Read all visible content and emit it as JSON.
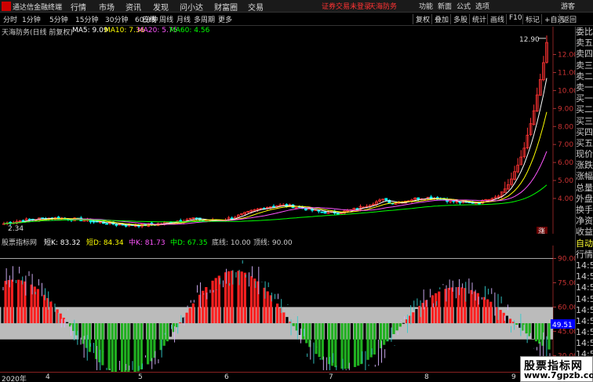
{
  "menubar": {
    "app_title": "通达信金融终端",
    "menus": [
      "行情",
      "市场",
      "资讯",
      "发现",
      "问小达",
      "财富圈",
      "交易"
    ],
    "warning": "证券交易未登录",
    "stock_name": "天海防务",
    "right_menus": [
      "功能",
      "新面",
      "公式",
      "选项"
    ],
    "user": "游客"
  },
  "toolbar": {
    "periods": [
      "分时",
      "1分钟",
      "5分钟",
      "15分钟",
      "30分钟",
      "60分钟",
      "日线",
      "周线",
      "月线",
      "多周期",
      "更多"
    ],
    "active_period": "日线",
    "buttons": [
      "复权",
      "叠加",
      "多股",
      "统计",
      "画线",
      "F10",
      "标记",
      "+自选",
      "返回"
    ]
  },
  "main_chart": {
    "title": "天海防务(日线 前复权)",
    "ma5": "MA5: 9.09",
    "ma10": "MA10: 7.36",
    "ma20": "MA20: 5.75",
    "ma60": "MA60: 4.56",
    "high_label": "12.90",
    "low_label": "2.34",
    "limit_badge": "涨",
    "colors": {
      "up": "#ff3333",
      "down": "#00ffff",
      "ma5": "#ffffff",
      "ma10": "#ffff00",
      "ma20": "#ff55ff",
      "ma60": "#00ff00",
      "bg": "#000000"
    },
    "y_axis": [
      "12.00",
      "11.00",
      "10.00",
      "9.00",
      "8.00",
      "7.00",
      "6.00",
      "5.00",
      "4.00"
    ],
    "y_min": 2.3,
    "y_max": 13.2
  },
  "right_panel": {
    "items": [
      {
        "label": "委比",
        "color": "normal"
      },
      {
        "label": "卖五",
        "color": "normal"
      },
      {
        "label": "卖四",
        "color": "normal"
      },
      {
        "label": "卖三",
        "color": "normal"
      },
      {
        "label": "卖二",
        "color": "normal"
      },
      {
        "label": "卖一",
        "color": "normal"
      },
      {
        "label": "买一",
        "color": "normal"
      },
      {
        "label": "买二",
        "color": "normal"
      },
      {
        "label": "买三",
        "color": "normal"
      },
      {
        "label": "买四",
        "color": "normal"
      },
      {
        "label": "买五",
        "color": "normal"
      },
      {
        "label": "现价",
        "color": "normal"
      },
      {
        "label": "涨跌",
        "color": "normal"
      },
      {
        "label": "涨幅",
        "color": "normal"
      },
      {
        "label": "总量",
        "color": "normal"
      },
      {
        "label": "外盘",
        "color": "normal"
      },
      {
        "label": "换手",
        "color": "normal"
      },
      {
        "label": "净资",
        "color": "normal"
      },
      {
        "label": "收益",
        "color": "normal"
      },
      {
        "label": "自动",
        "color": "yellow"
      },
      {
        "label": "行情",
        "color": "normal"
      },
      {
        "label": "14:5",
        "color": "normal"
      },
      {
        "label": "14:5",
        "color": "normal"
      },
      {
        "label": "14:5",
        "color": "normal"
      },
      {
        "label": "14:5",
        "color": "normal"
      },
      {
        "label": "14:5",
        "color": "normal"
      },
      {
        "label": "14:5",
        "color": "normal"
      },
      {
        "label": "14:5",
        "color": "normal"
      },
      {
        "label": "14:5",
        "color": "normal"
      },
      {
        "label": "14:5",
        "color": "normal"
      },
      {
        "label": "14:5",
        "color": "normal"
      }
    ]
  },
  "indicator": {
    "name": "股票指标网",
    "k": "短K: 83.32",
    "d": "短D: 84.34",
    "mk": "中K: 81.73",
    "md": "中D: 67.35",
    "bottom_line": "底线: 10.00",
    "top_line": "顶线: 90.00",
    "value_box": "49.51",
    "y_axis": [
      "90.00",
      "75.00",
      "60.00",
      "45.00",
      "30.00"
    ]
  },
  "date_axis": {
    "labels": [
      "2020年",
      "4",
      "5",
      "6",
      "7",
      "8",
      "9"
    ]
  },
  "watermark": {
    "line1": "股票指标网",
    "line2": "www.7gpzb.com"
  }
}
